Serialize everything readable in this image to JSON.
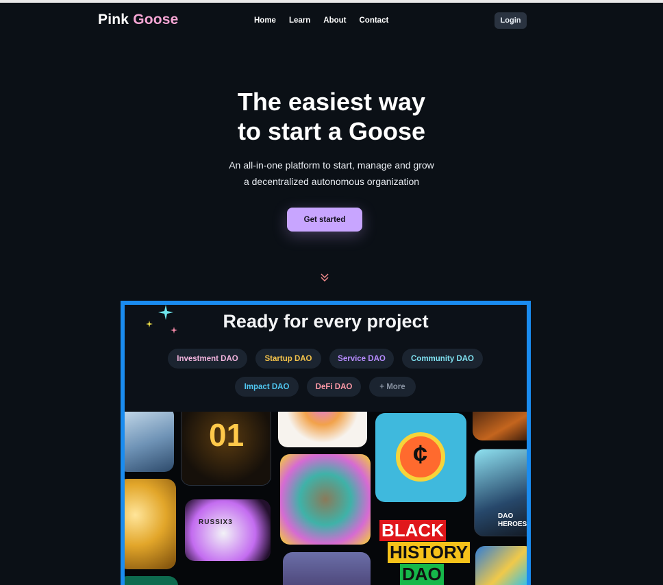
{
  "brand": {
    "part1": "Pink",
    "part2": "Goose"
  },
  "nav": {
    "items": [
      "Home",
      "Learn",
      "About",
      "Contact"
    ],
    "login": "Login"
  },
  "hero": {
    "title_line1": "The easiest way",
    "title_line2": "to start a Goose",
    "subtitle_line1": "An all-in-one platform to start, manage and grow",
    "subtitle_line2": "a decentralized autonomous organization",
    "cta": "Get started"
  },
  "section": {
    "title": "Ready for every project",
    "chips": [
      {
        "label": "Investment DAO",
        "color": "#f2b4de"
      },
      {
        "label": "Startup DAO",
        "color": "#f4c34a"
      },
      {
        "label": "Service DAO",
        "color": "#b78cff"
      },
      {
        "label": "Community DAO",
        "color": "#7fe0ef"
      },
      {
        "label": "Impact DAO",
        "color": "#4fc6f0"
      },
      {
        "label": "DeFi DAO",
        "color": "#ff9aa8"
      },
      {
        "label": "+ More",
        "color": "#8a94a3"
      }
    ]
  },
  "gallery": {
    "tile_01": "01",
    "tile_card": "RUSSIX3",
    "tile_black_history": [
      "BLACK",
      "HISTORY",
      "DAO"
    ],
    "tile_dao_heroes": [
      "DAO",
      "HEROES"
    ],
    "coin_symbol": "¢"
  },
  "colors": {
    "accent": "#c8a5ff",
    "brand_pink": "#f6a6d4",
    "frame": "#1a8cf0",
    "bg": "#0b1016"
  }
}
